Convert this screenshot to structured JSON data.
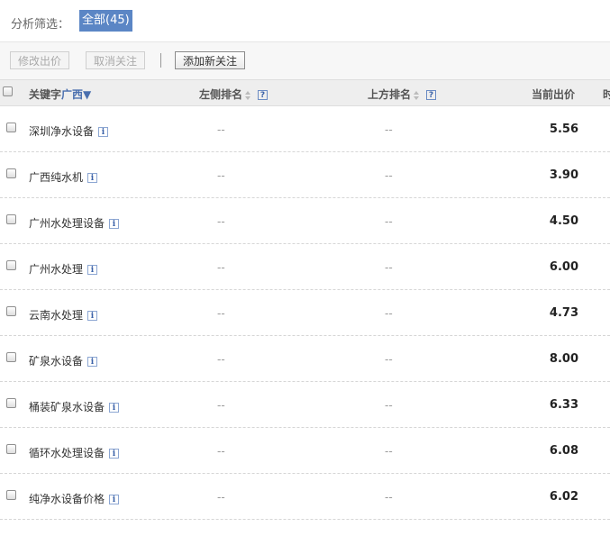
{
  "filter": {
    "label": "分析筛选：",
    "chip": "全部(45)"
  },
  "toolbar": {
    "edit_bid": "修改出价",
    "unfollow": "取消关注",
    "add_follow": "添加新关注"
  },
  "header": {
    "keyword": "关键字",
    "region": "广西▼",
    "left_rank": "左侧排名",
    "top_rank": "上方排名",
    "current_bid": "当前出价",
    "clipped": "时",
    "help": "?"
  },
  "rows": [
    {
      "keyword": "深圳净水设备",
      "left": "--",
      "top": "--",
      "bid": "5.56"
    },
    {
      "keyword": "广西纯水机",
      "left": "--",
      "top": "--",
      "bid": "3.90"
    },
    {
      "keyword": "广州水处理设备",
      "left": "--",
      "top": "--",
      "bid": "4.50"
    },
    {
      "keyword": "广州水处理",
      "left": "--",
      "top": "--",
      "bid": "6.00"
    },
    {
      "keyword": "云南水处理",
      "left": "--",
      "top": "--",
      "bid": "4.73"
    },
    {
      "keyword": "矿泉水设备",
      "left": "--",
      "top": "--",
      "bid": "8.00"
    },
    {
      "keyword": "桶装矿泉水设备",
      "left": "--",
      "top": "--",
      "bid": "6.33"
    },
    {
      "keyword": "循环水处理设备",
      "left": "--",
      "top": "--",
      "bid": "6.08"
    },
    {
      "keyword": "纯净水设备价格",
      "left": "--",
      "top": "--",
      "bid": "6.02"
    }
  ],
  "info_glyph": "i"
}
